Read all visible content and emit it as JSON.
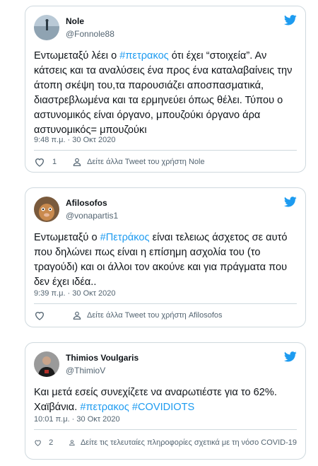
{
  "tweets": [
    {
      "display_name": "Nole",
      "handle": "@Fonnole88",
      "text_segments": [
        {
          "t": "Εντωμεταξύ λέει ο ",
          "tag": false
        },
        {
          "t": "#πετρακος",
          "tag": true
        },
        {
          "t": " ότι έχει “στοιχεία”. Αν κάτσεις και τα αναλύσεις ένα προς ένα καταλαβαίνεις την άτοπη σκέψη του,τα παρουσιάζει αποσπασματικά, διαστρεβλωμένα και τα ερμηνεύει όπως θέλει. Τύπου ο αστυνομικός είναι όργανο, μπουζούκι όργανο άρα αστυνομικός= μπουζούκι",
          "tag": false
        }
      ],
      "timestamp": "9:48 π.μ. · 30 Οκτ 2020",
      "likes": "1",
      "author_link": "Δείτε άλλα Tweet του χρήστη Nole"
    },
    {
      "display_name": "Afilosofos",
      "handle": "@vonapartis1",
      "text_segments": [
        {
          "t": "Εντωμεταξύ ο ",
          "tag": false
        },
        {
          "t": "#Πετράκος",
          "tag": true
        },
        {
          "t": " είναι τελειως άσχετος σε αυτό που δηλώνει πως είναι η επίσημη ασχολία του (το τραγούδι) και οι άλλοι τον ακούνε και για πράγματα που δεν έχει ιδέα..",
          "tag": false
        }
      ],
      "timestamp": "9:39 π.μ. · 30 Οκτ 2020",
      "likes": "",
      "author_link": "Δείτε άλλα Tweet του χρήστη Afilosofos"
    },
    {
      "display_name": "Thimios Voulgaris",
      "handle": "@ThimioV",
      "text_segments": [
        {
          "t": "Και μετά εσείς συνεχίζετε να αναρωτιέστε για το 62%. Χαϊβάνια. ",
          "tag": false
        },
        {
          "t": "#πετρακος",
          "tag": true
        },
        {
          "t": " ",
          "tag": false
        },
        {
          "t": "#COVIDIOTS",
          "tag": true
        }
      ],
      "timestamp": "10:01 π.μ. · 30 Οκτ 2020",
      "likes": "2",
      "author_link": "Δείτε τις τελευταίες πληροφορίες σχετικά με τη νόσο COVID-19"
    }
  ],
  "colors": {
    "hashtag": "#1d9bf0",
    "twitter_bird": "#1d9bf0",
    "secondary_text": "#536471",
    "border": "#cfd9de"
  },
  "icons": [
    "twitter-bird-icon",
    "heart-icon",
    "person-icon"
  ]
}
